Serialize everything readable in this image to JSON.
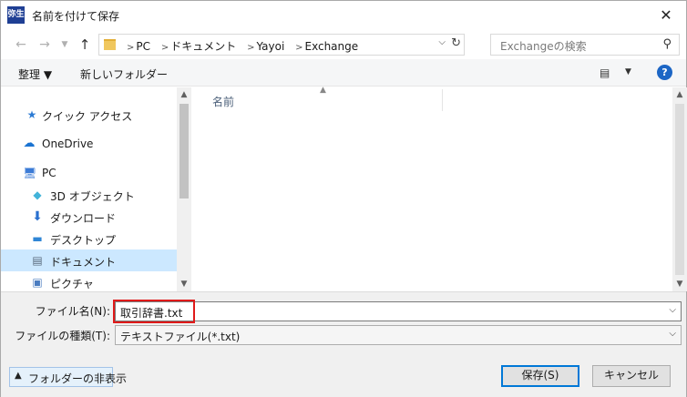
{
  "window": {
    "icon_text": "弥生",
    "title": "名前を付けて保存"
  },
  "address": {
    "crumbs": [
      "PC",
      "ドキュメント",
      "Yayoi",
      "Exchange"
    ]
  },
  "search": {
    "placeholder": "Exchangeの検索"
  },
  "toolbar": {
    "organize_label": "整理 ▼",
    "new_folder_label": "新しいフォルダー",
    "help_label": "?"
  },
  "nav": {
    "items": [
      {
        "label": "クイック アクセス",
        "icon": "star-icon"
      },
      {
        "label": "OneDrive",
        "icon": "cloud-icon"
      },
      {
        "label": "PC",
        "icon": "computer-icon"
      },
      {
        "label": "3D オブジェクト",
        "icon": "cube-icon"
      },
      {
        "label": "ダウンロード",
        "icon": "download-icon"
      },
      {
        "label": "デスクトップ",
        "icon": "desktop-icon"
      },
      {
        "label": "ドキュメント",
        "icon": "document-icon",
        "selected": true
      },
      {
        "label": "ピクチャ",
        "icon": "picture-icon"
      }
    ]
  },
  "filelist": {
    "column_name": "名前"
  },
  "form": {
    "filename_label": "ファイル名(N):",
    "filename_value": "取引辞書.txt",
    "filetype_label": "ファイルの種類(T):",
    "filetype_value": "テキストファイル(*.txt)"
  },
  "footer": {
    "hide_folders_label": "フォルダーの非表示",
    "save_label": "保存(S)",
    "cancel_label": "キャンセル"
  },
  "colors": {
    "accent": "#0078d7",
    "selection": "#cce8ff",
    "highlight_box": "#e01a1a",
    "help": "#1c66c5"
  }
}
